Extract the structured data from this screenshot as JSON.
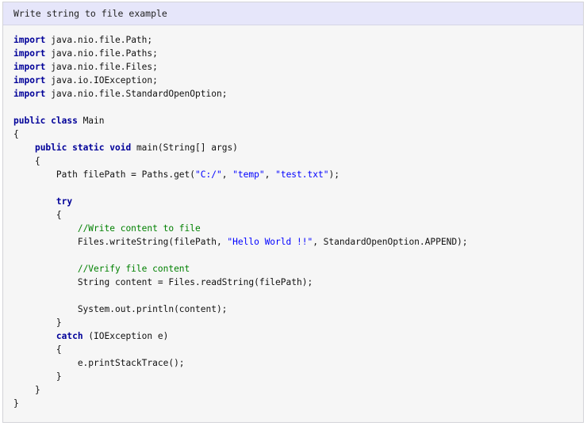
{
  "header": {
    "title": "Write string to file example"
  },
  "code": {
    "lines": [
      [
        {
          "t": "kw",
          "s": "import"
        },
        {
          "t": "plain",
          "s": " java.nio.file.Path;"
        }
      ],
      [
        {
          "t": "kw",
          "s": "import"
        },
        {
          "t": "plain",
          "s": " java.nio.file.Paths;"
        }
      ],
      [
        {
          "t": "kw",
          "s": "import"
        },
        {
          "t": "plain",
          "s": " java.nio.file.Files;"
        }
      ],
      [
        {
          "t": "kw",
          "s": "import"
        },
        {
          "t": "plain",
          "s": " java.io.IOException;"
        }
      ],
      [
        {
          "t": "kw",
          "s": "import"
        },
        {
          "t": "plain",
          "s": " java.nio.file.StandardOpenOption;"
        }
      ],
      [],
      [
        {
          "t": "kw",
          "s": "public class"
        },
        {
          "t": "plain",
          "s": " Main"
        }
      ],
      [
        {
          "t": "plain",
          "s": "{"
        }
      ],
      [
        {
          "t": "plain",
          "s": "    "
        },
        {
          "t": "kw",
          "s": "public static void"
        },
        {
          "t": "plain",
          "s": " main(String[] args)"
        }
      ],
      [
        {
          "t": "plain",
          "s": "    {"
        }
      ],
      [
        {
          "t": "plain",
          "s": "        Path filePath = Paths.get("
        },
        {
          "t": "str",
          "s": "\"C:/\""
        },
        {
          "t": "plain",
          "s": ", "
        },
        {
          "t": "str",
          "s": "\"temp\""
        },
        {
          "t": "plain",
          "s": ", "
        },
        {
          "t": "str",
          "s": "\"test.txt\""
        },
        {
          "t": "plain",
          "s": ");"
        }
      ],
      [],
      [
        {
          "t": "plain",
          "s": "        "
        },
        {
          "t": "kw",
          "s": "try"
        }
      ],
      [
        {
          "t": "plain",
          "s": "        {"
        }
      ],
      [
        {
          "t": "plain",
          "s": "            "
        },
        {
          "t": "com",
          "s": "//Write content to file"
        }
      ],
      [
        {
          "t": "plain",
          "s": "            Files.writeString(filePath, "
        },
        {
          "t": "str",
          "s": "\"Hello World !!\""
        },
        {
          "t": "plain",
          "s": ", StandardOpenOption.APPEND);"
        }
      ],
      [],
      [
        {
          "t": "plain",
          "s": "            "
        },
        {
          "t": "com",
          "s": "//Verify file content"
        }
      ],
      [
        {
          "t": "plain",
          "s": "            String content = Files.readString(filePath);"
        }
      ],
      [],
      [
        {
          "t": "plain",
          "s": "            System.out.println(content);"
        }
      ],
      [
        {
          "t": "plain",
          "s": "        }"
        }
      ],
      [
        {
          "t": "plain",
          "s": "        "
        },
        {
          "t": "kw",
          "s": "catch"
        },
        {
          "t": "plain",
          "s": " (IOException e)"
        }
      ],
      [
        {
          "t": "plain",
          "s": "        {"
        }
      ],
      [
        {
          "t": "plain",
          "s": "            e.printStackTrace();"
        }
      ],
      [
        {
          "t": "plain",
          "s": "        }"
        }
      ],
      [
        {
          "t": "plain",
          "s": "    }"
        }
      ],
      [
        {
          "t": "plain",
          "s": "}"
        }
      ]
    ]
  }
}
